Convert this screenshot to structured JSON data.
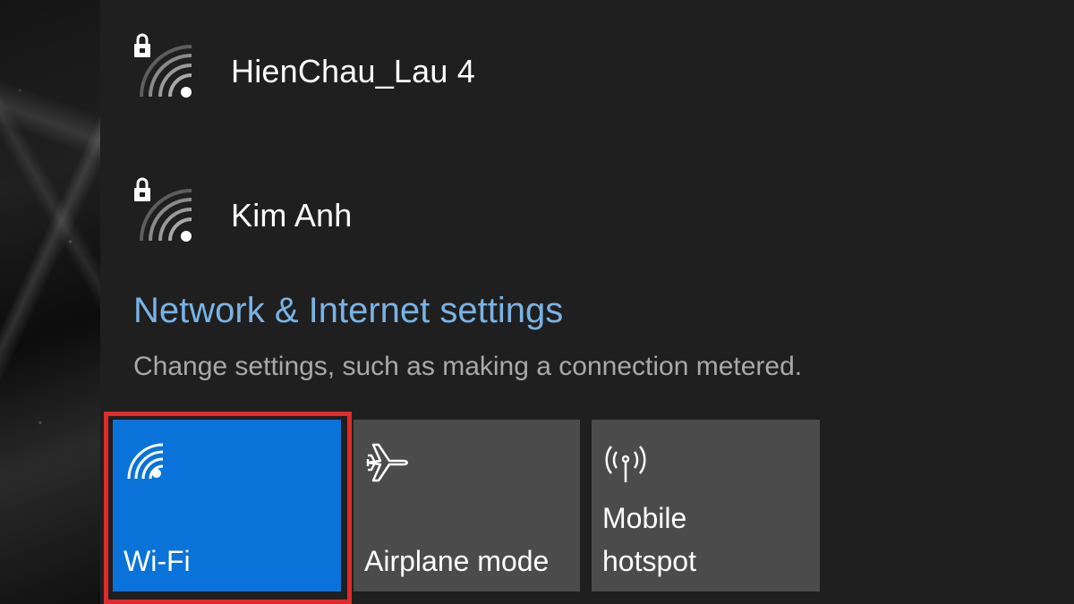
{
  "networks": [
    {
      "name": "HienChau_Lau 4",
      "icon": "wifi-secured-icon"
    },
    {
      "name": "Kim Anh",
      "icon": "wifi-secured-icon"
    }
  ],
  "settings": {
    "link_label": "Network & Internet settings",
    "description": "Change settings, such as making a connection metered."
  },
  "quick_actions": [
    {
      "label": "Wi-Fi",
      "icon": "wifi-icon",
      "active": true
    },
    {
      "label": "Airplane mode",
      "icon": "airplane-icon",
      "active": false
    },
    {
      "label": "Mobile\nhotspot",
      "icon": "hotspot-icon",
      "active": false
    }
  ],
  "colors": {
    "panel_bg": "#1f1f1f",
    "accent": "#0a73d9",
    "link": "#79b3e6",
    "tile_bg": "#4b4b4b",
    "highlight": "#e02b2b"
  }
}
